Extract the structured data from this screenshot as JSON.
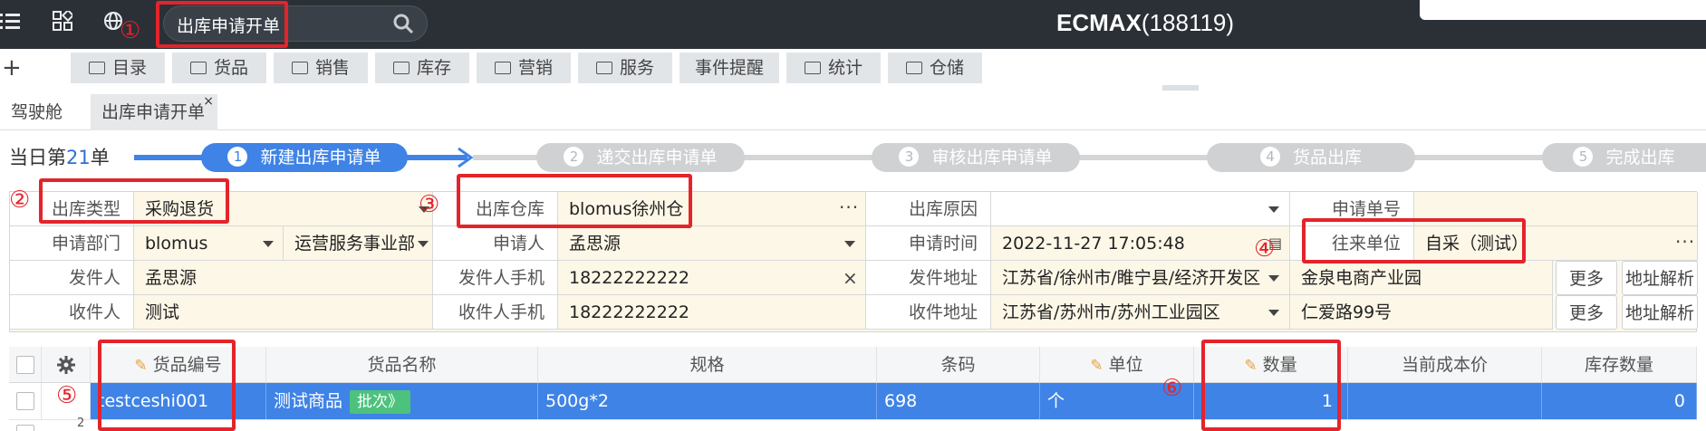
{
  "topbar": {
    "menu_icon": "hamburger-icon",
    "apps_icon": "apps-grid-icon",
    "globe_icon": "globe-icon",
    "search_value": "出库申请开单",
    "search_icon": "search-icon",
    "title_brand": "ECMAX",
    "title_account": "(188119)"
  },
  "menubar": {
    "plus_icon": "plus-icon",
    "items": [
      {
        "label": "目录",
        "icon": "folder-icon"
      },
      {
        "label": "货品",
        "icon": "folder-icon"
      },
      {
        "label": "销售",
        "icon": "folder-icon"
      },
      {
        "label": "库存",
        "icon": "folder-icon"
      },
      {
        "label": "营销",
        "icon": "folder-icon"
      },
      {
        "label": "服务",
        "icon": "folder-icon"
      },
      {
        "label": "事件提醒",
        "icon": ""
      },
      {
        "label": "统计",
        "icon": "folder-icon"
      },
      {
        "label": "仓储",
        "icon": "folder-icon"
      }
    ]
  },
  "tabs": [
    {
      "label": "驾驶舱"
    },
    {
      "label": "出库申请开单",
      "close": "×"
    }
  ],
  "progress": {
    "count_prefix": "当日第",
    "count_num": "21",
    "count_suffix": "单",
    "steps": [
      {
        "num": "1",
        "label": "新建出库申请单"
      },
      {
        "num": "2",
        "label": "递交出库申请单"
      },
      {
        "num": "3",
        "label": "审核出库申请单"
      },
      {
        "num": "4",
        "label": "货品出库"
      },
      {
        "num": "5",
        "label": "完成出库"
      }
    ],
    "colors": {
      "active": "#3f83e6",
      "inactive": "#cfd1d3"
    }
  },
  "form": {
    "out_type_label": "出库类型",
    "out_type_value": "采购退货",
    "warehouse_label": "出库仓库",
    "warehouse_value": "blomus徐州仓",
    "reason_label": "出库原因",
    "reason_value": "",
    "request_no_label": "申请单号",
    "request_no_value": "",
    "dept_label": "申请部门",
    "dept_value": "blomus",
    "dept_value2": "运营服务事业部",
    "applicant_label": "申请人",
    "applicant_value": "孟思源",
    "time_label": "申请时间",
    "time_value": "2022-11-27 17:05:48",
    "partner_label": "往来单位",
    "partner_value": "自采（测试）",
    "sender_label": "发件人",
    "sender_value": "孟思源",
    "sender_phone_label": "发件人手机",
    "sender_phone_value": "18222222222",
    "sender_addr_label": "发件地址",
    "sender_addr_value": "江苏省/徐州市/睢宁县/经济开发区",
    "sender_addr_detail": "金泉电商产业园",
    "receiver_label": "收件人",
    "receiver_value": "测试",
    "receiver_phone_label": "收件人手机",
    "receiver_phone_value": "18222222222",
    "receiver_addr_label": "收件地址",
    "receiver_addr_value": "江苏省/苏州市/苏州工业园区",
    "receiver_addr_detail": "仁爱路99号",
    "more_label": "更多",
    "parse_label": "地址解析",
    "clear_icon": "×"
  },
  "grid": {
    "settings_icon": "gear-icon",
    "columns": [
      "货品编号",
      "货品名称",
      "规格",
      "条码",
      "单位",
      "数量",
      "当前成本价",
      "库存数量"
    ],
    "row": {
      "code": "testceshi001",
      "name": "测试商品",
      "batch": "批次》",
      "spec": "500g*2",
      "barcode": "698",
      "unit": "个",
      "qty": "1",
      "cost": "",
      "stock": "0"
    },
    "next_row_index": "2"
  },
  "annotations": [
    "①",
    "②",
    "③",
    "④",
    "⑤",
    "⑥"
  ]
}
